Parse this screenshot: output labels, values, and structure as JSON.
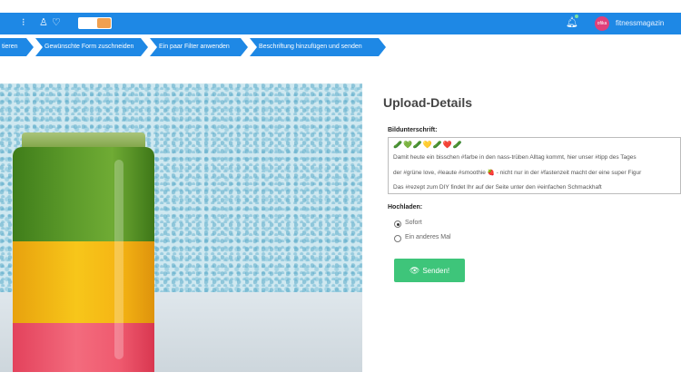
{
  "topbar": {
    "user_name": "fitnessmagazin",
    "avatar_text": "ofika"
  },
  "steps": [
    {
      "label": "tieren"
    },
    {
      "label": "Gewünschte Form zuschneiden"
    },
    {
      "label": "Ein paar Filter anwenden"
    },
    {
      "label": "Beschriftung hinzufügen und senden"
    }
  ],
  "upload": {
    "title": "Upload-Details",
    "caption_label": "Bildunterschrift:",
    "caption_emojis": "🥒💚🥒💛🥒❤️🥒",
    "caption_lines": [
      "Damit heute ein bisschen #farbe in den nass-trüben Alltag kommt, hier unser #tipp des Tages",
      "der #grüne love, #leaute #smoothie 🍓 - nicht nur in der #fastenzeit macht der eine super Figur",
      "Das #rezept zum DIY findet Ihr auf der Seite unter den #einfachen Schmackhaft"
    ],
    "upload_label": "Hochladen:",
    "options": [
      {
        "label": "Sofort",
        "selected": true
      },
      {
        "label": "Ein anderes Mal",
        "selected": false
      }
    ],
    "send_label": "Senden!"
  },
  "colors": {
    "primary": "#1e88e5",
    "send": "#3ec57a"
  }
}
